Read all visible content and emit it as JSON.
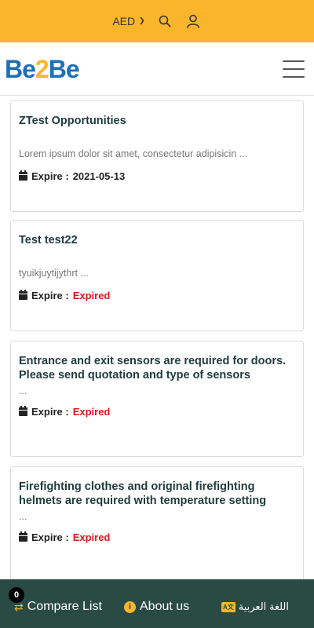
{
  "topbar": {
    "currency": "AED",
    "icons": [
      "chevron-down-icon",
      "search-icon",
      "user-icon"
    ]
  },
  "header": {
    "logo_parts": [
      "Be",
      "2",
      "Be"
    ],
    "menu_icon": "hamburger-menu-icon"
  },
  "cards": [
    {
      "title": "ZTest Opportunities",
      "description": "Lorem ipsum dolor sit amet, consectetur adipisicin ...",
      "expire_label": "Expire :",
      "expire_value": "2021-05-13",
      "status": "date"
    },
    {
      "title": "Test test22",
      "description": "tyuikjuytijythrt ...",
      "expire_label": "Expire :",
      "expire_value": "Expired",
      "status": "expired"
    },
    {
      "title": "Entrance and exit sensors are required for doors. Please send quotation and type of sensors",
      "description": "...",
      "expire_label": "Expire :",
      "expire_value": "Expired",
      "status": "expired"
    },
    {
      "title": "Firefighting clothes and original firefighting helmets are required with temperature setting",
      "description": "...",
      "expire_label": "Expire :",
      "expire_value": "Expired",
      "status": "expired"
    }
  ],
  "bottombar": {
    "compare_label": "Compare List",
    "compare_count": "0",
    "about_label": "About us",
    "language_label": "اللغة العربية",
    "language_icon_text": "A文"
  },
  "colors": {
    "accent": "#f9b52c",
    "brand_blue": "#1d6fb8",
    "footer": "#2a4a44",
    "expired": "#e0161b"
  }
}
